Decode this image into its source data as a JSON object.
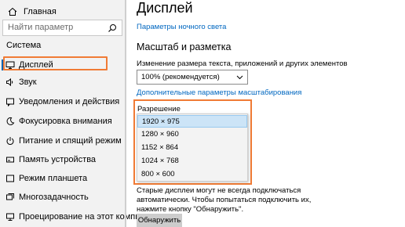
{
  "sidebar": {
    "home_label": "Главная",
    "search_placeholder": "Найти параметр",
    "section_label": "Система",
    "items": [
      {
        "label": "Дисплей",
        "icon": "monitor-icon"
      },
      {
        "label": "Звук",
        "icon": "speaker-icon"
      },
      {
        "label": "Уведомления и действия",
        "icon": "notification-icon"
      },
      {
        "label": "Фокусировка внимания",
        "icon": "moon-icon"
      },
      {
        "label": "Питание и спящий режим",
        "icon": "power-icon"
      },
      {
        "label": "Память устройства",
        "icon": "storage-icon"
      },
      {
        "label": "Режим планшета",
        "icon": "tablet-icon"
      },
      {
        "label": "Многозадачность",
        "icon": "multitask-icon"
      },
      {
        "label": "Проецирование на этот компьютер",
        "icon": "projection-icon"
      }
    ]
  },
  "main": {
    "title": "Дисплей",
    "night_light_link": "Параметры ночного света",
    "scale_header": "Масштаб и разметка",
    "scale_label": "Изменение размера текста, приложений и других элементов",
    "scale_value": "100% (рекомендуется)",
    "advanced_scale_link": "Дополнительные параметры масштабирования",
    "resolution_label": "Разрешение",
    "resolution_options": [
      "1920 × 975",
      "1280 × 960",
      "1152 × 864",
      "1024 × 768",
      "800 × 600"
    ],
    "detect_note": "Старые дисплеи могут не всегда подключаться автоматически. Чтобы попытаться подключить их, нажмите кнопку \"Обнаружить\".",
    "detect_button": "Обнаружить"
  },
  "colors": {
    "accent": "#0067c0",
    "highlight_border": "#f07b35",
    "selected_option": "#cce4f7"
  }
}
